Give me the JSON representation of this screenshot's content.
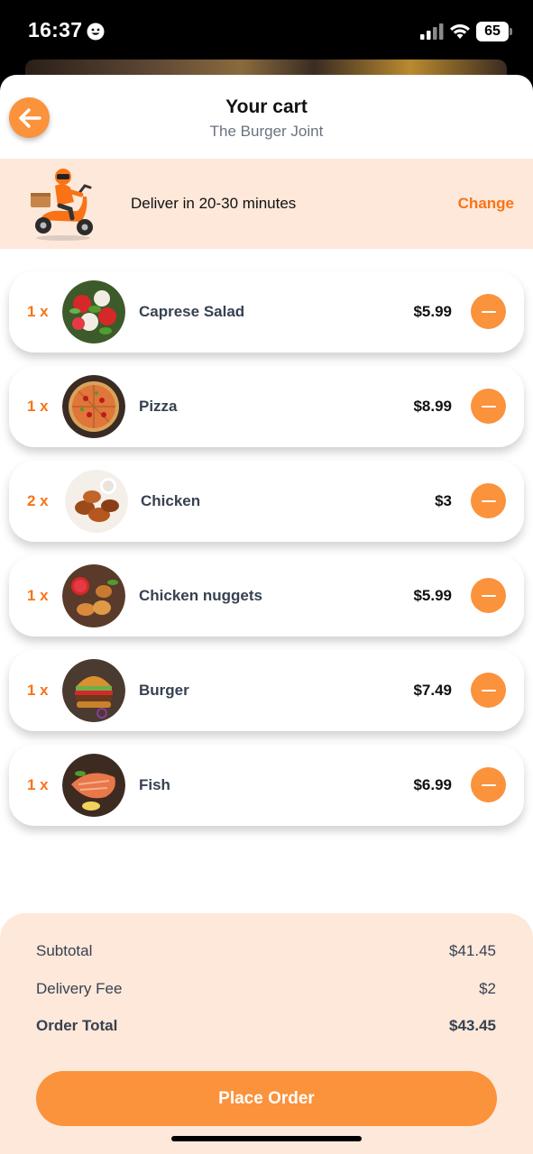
{
  "status": {
    "time": "16:37",
    "battery": "65",
    "icons": [
      "smiley-icon",
      "signal-icon",
      "wifi-icon",
      "battery-icon"
    ]
  },
  "header": {
    "title": "Your cart",
    "restaurant": "The Burger Joint",
    "back_icon": "arrow-left-icon"
  },
  "delivery": {
    "text": "Deliver in 20-30 minutes",
    "change_label": "Change"
  },
  "items": [
    {
      "qty": "1 x",
      "name": "Caprese Salad",
      "price": "$5.99"
    },
    {
      "qty": "1 x",
      "name": "Pizza",
      "price": "$8.99"
    },
    {
      "qty": "2 x",
      "name": "Chicken",
      "price": "$3"
    },
    {
      "qty": "1 x",
      "name": "Chicken nuggets",
      "price": "$5.99"
    },
    {
      "qty": "1 x",
      "name": "Burger",
      "price": "$7.49"
    },
    {
      "qty": "1 x",
      "name": "Fish",
      "price": "$6.99"
    }
  ],
  "totals": {
    "subtotal_label": "Subtotal",
    "subtotal_value": "$41.45",
    "delivery_fee_label": "Delivery Fee",
    "delivery_fee_value": "$2",
    "order_total_label": "Order Total",
    "order_total_value": "$43.45"
  },
  "place_order_label": "Place Order",
  "colors": {
    "accent": "#fb923c",
    "accent_text": "#f97316",
    "banner_bg": "#fde8da"
  }
}
